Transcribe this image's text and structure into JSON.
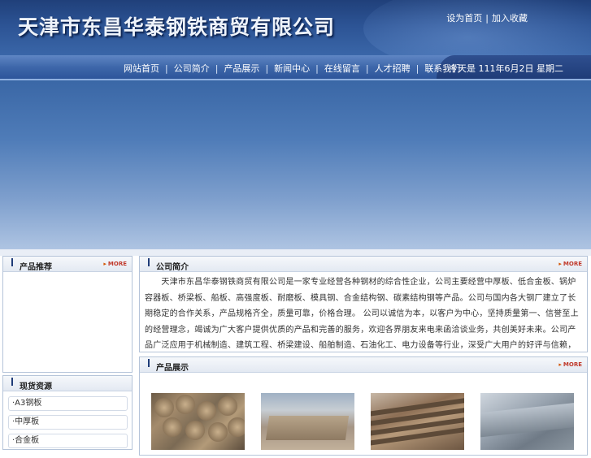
{
  "header": {
    "company_name": "天津市东昌华泰钢铁商贸有限公司",
    "top_links": [
      "设为首页",
      "加入收藏"
    ],
    "top_links_separator": "|"
  },
  "nav": {
    "items": [
      "网站首页",
      "公司简介",
      "产品展示",
      "新闻中心",
      "在线留言",
      "人才招聘",
      "联系我们"
    ],
    "separator": "|",
    "date_text": "今天是 111年6月2日 星期二"
  },
  "sidebar": {
    "recommend": {
      "title": "产品推荐",
      "more": "MORE"
    },
    "stock": {
      "title": "现货资源",
      "items": [
        "·A3钢板",
        "·中厚板",
        "·合金板"
      ]
    }
  },
  "intro": {
    "title": "公司简介",
    "more": "MORE",
    "text": "　　天津市东昌华泰钢铁商贸有限公司是一家专业经营各种钢材的综合性企业，公司主要经营中厚板、低合金板、锅炉容器板、桥梁板、船板、高强度板、耐磨板、模具钢、合金结构钢、碳素结构钢等产品。公司与国内各大钢厂建立了长期稳定的合作关系，产品规格齐全，质量可靠，价格合理。 公司以诚信为本，以客户为中心，坚持质量第一、信誉至上的经营理念，竭诚为广大客户提供优质的产品和完善的服务，欢迎各界朋友来电来函洽谈业务，共创美好未来。公司产品广泛应用于机械制造、建筑工程、桥梁建设、船舶制造、石油化工、电力设备等行业，深受广大用户的好评与信赖，公司拥有大型仓储基地及先进的切割加工设备，可根据客户要求进行加工配送。 公司现货库存充足，规格品种齐全，可满足不同客户的需求，欢迎广大新老客户前来洽谈合作，公司将竭诚为您服务，期待与您携手共进、互利共赢、共同发展，公司主要经营钢板的规格：厚度：8-650mm.宽度1500-4020mm.长度3000-18800mm。"
  },
  "products": {
    "title": "产品展示",
    "more": "MORE",
    "images": [
      "round-bars-image",
      "steel-slab-image",
      "steel-plates-image",
      "steel-sheet-image"
    ]
  },
  "colors": {
    "header_dark": "#20407a",
    "nav_blue": "#3e67aa",
    "more_red": "#c0392b"
  }
}
